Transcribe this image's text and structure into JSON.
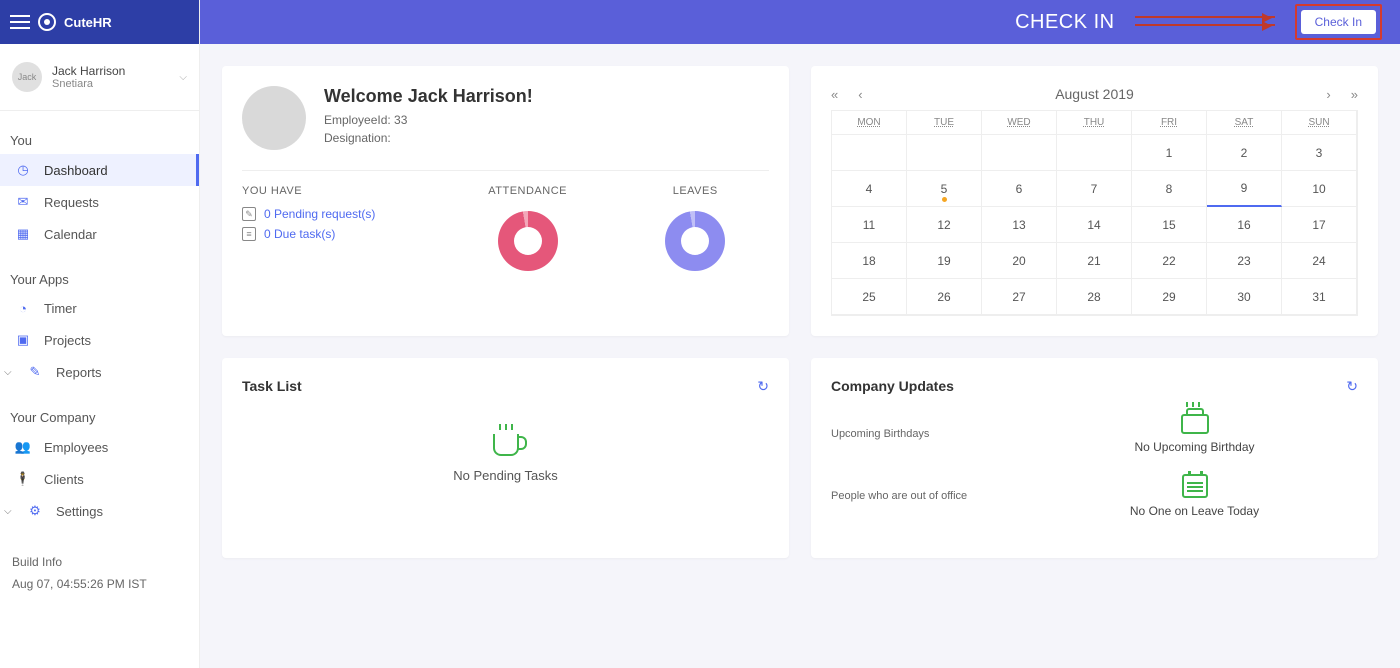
{
  "brand": "CuteHR",
  "topbar": {
    "title": "CHECK IN",
    "button": "Check In"
  },
  "user": {
    "avatar_text": "Jack",
    "name": "Jack Harrison",
    "org": "Snetiara"
  },
  "nav": {
    "you": {
      "title": "You",
      "items": [
        {
          "label": "Dashboard",
          "active": true
        },
        {
          "label": "Requests"
        },
        {
          "label": "Calendar"
        }
      ]
    },
    "apps": {
      "title": "Your Apps",
      "items": [
        {
          "label": "Timer"
        },
        {
          "label": "Projects"
        },
        {
          "label": "Reports",
          "caret": true
        }
      ]
    },
    "company": {
      "title": "Your Company",
      "items": [
        {
          "label": "Employees"
        },
        {
          "label": "Clients"
        },
        {
          "label": "Settings",
          "caret": true
        }
      ]
    }
  },
  "build": {
    "title": "Build Info",
    "stamp": "Aug 07, 04:55:26 PM IST"
  },
  "welcome": {
    "greeting": "Welcome Jack Harrison!",
    "emp_label": "EmployeeId: 33",
    "desig_label": "Designation:",
    "youhave": "YOU HAVE",
    "pending": "0 Pending request(s)",
    "due": "0 Due task(s)",
    "attendance": "ATTENDANCE",
    "leaves": "LEAVES"
  },
  "calendar": {
    "month": "August 2019",
    "dow": [
      "MON",
      "TUE",
      "WED",
      "THU",
      "FRI",
      "SAT",
      "SUN"
    ],
    "lead_blanks": 4,
    "days": 31,
    "today": 5,
    "fri_highlight": 9
  },
  "tasks": {
    "title": "Task List",
    "empty": "No Pending Tasks"
  },
  "updates": {
    "title": "Company Updates",
    "birthdays_label": "Upcoming Birthdays",
    "birthdays_empty": "No Upcoming Birthday",
    "ooo_label": "People who are out of office",
    "ooo_empty": "No One on Leave Today"
  }
}
